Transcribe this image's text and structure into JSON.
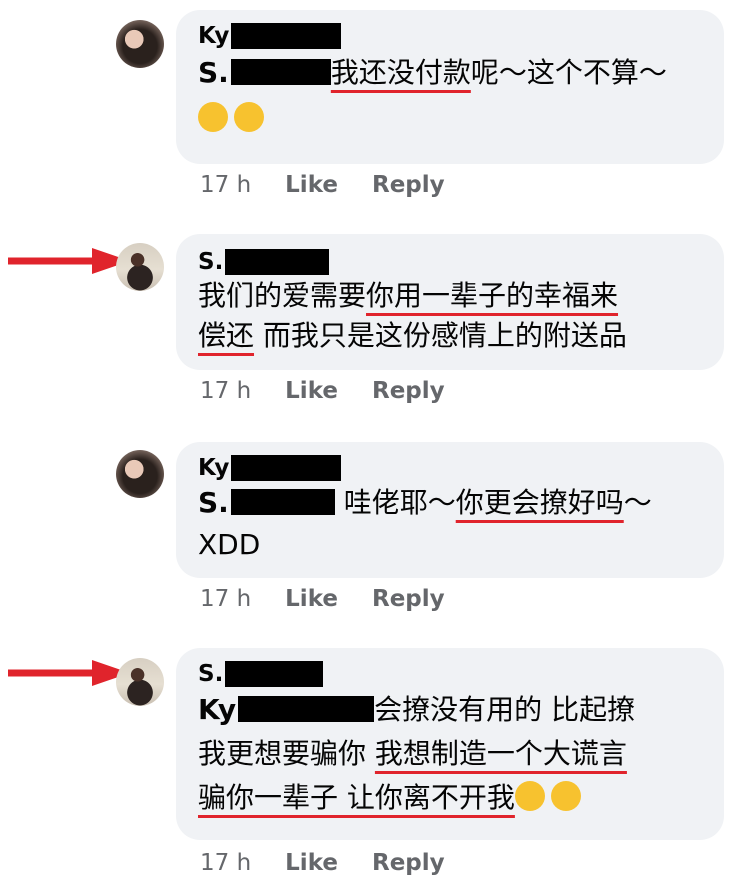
{
  "comments": [
    {
      "author": "Ky",
      "mention": "S.",
      "text_plain_1": "",
      "text_ul_1": "我还没付款",
      "text_plain_2": "呢～这个不算～",
      "emojis": [
        "joy-emoji",
        "joy-emoji"
      ],
      "time": "17 h",
      "like": "Like",
      "reply": "Reply"
    },
    {
      "author": "S.",
      "line1_plain": "我们的爱需要",
      "line1_ul": "你用一辈子的幸福来",
      "line2_ul": "偿还",
      "line2_plain": " 而我只是这份感情上的附送品",
      "time": "17 h",
      "like": "Like",
      "reply": "Reply"
    },
    {
      "author": "Ky",
      "mention": "S.",
      "plain_1": " 哇佬耶～",
      "ul_1": "你更会撩好吗",
      "plain_2": "～",
      "line2": "XDD",
      "time": "17 h",
      "like": "Like",
      "reply": "Reply"
    },
    {
      "author": "S.",
      "mention": "Ky",
      "plain_1": "会撩没有用的 比起撩",
      "plain_2": "我更想要骗你 ",
      "ul_1": "我想制造一个大谎言",
      "ul_2": "骗你一辈子 让你离不开我",
      "emojis": [
        "kiss-emoji",
        "kiss-emoji"
      ],
      "time": "17 h",
      "like": "Like",
      "reply": "Reply"
    }
  ]
}
